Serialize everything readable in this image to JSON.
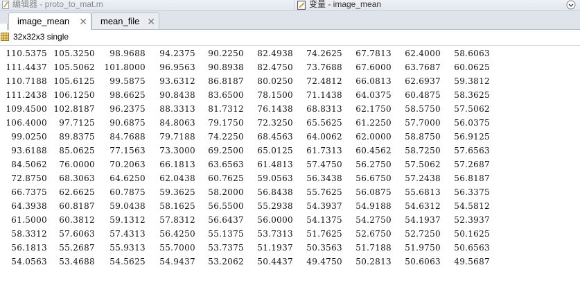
{
  "window": {
    "left_title": "编辑器 - proto_to_mat.m",
    "right_title": "变量 - image_mean"
  },
  "tabs": [
    {
      "label": "image_mean",
      "active": true
    },
    {
      "label": "mean_file",
      "active": false
    }
  ],
  "variable_info": "32x32x3 single",
  "matrix": [
    [
      "110.5375",
      "105.3250",
      "98.9688",
      "94.2375",
      "90.2250",
      "82.4938",
      "74.2625",
      "67.7813",
      "62.4000",
      "58.6063"
    ],
    [
      "111.4437",
      "105.5062",
      "101.8000",
      "96.9563",
      "90.8938",
      "82.4750",
      "73.7688",
      "67.6000",
      "63.7687",
      "60.0625"
    ],
    [
      "110.7188",
      "105.6125",
      "99.5875",
      "93.6312",
      "86.8187",
      "80.0250",
      "72.4812",
      "66.0813",
      "62.6937",
      "59.3812"
    ],
    [
      "111.2438",
      "106.1250",
      "98.6625",
      "90.8438",
      "83.6500",
      "78.1500",
      "71.1438",
      "64.0375",
      "60.4875",
      "58.3625"
    ],
    [
      "109.4500",
      "102.8187",
      "96.2375",
      "88.3313",
      "81.7312",
      "76.1438",
      "68.8313",
      "62.1750",
      "58.5750",
      "57.5062"
    ],
    [
      "106.4000",
      "97.7125",
      "90.6875",
      "84.8063",
      "79.1750",
      "72.3250",
      "65.5625",
      "61.2250",
      "57.7000",
      "56.0375"
    ],
    [
      "99.0250",
      "89.8375",
      "84.7688",
      "79.7188",
      "74.2250",
      "68.4563",
      "64.0062",
      "62.0000",
      "58.8750",
      "56.9125"
    ],
    [
      "93.6188",
      "85.0625",
      "77.1563",
      "73.3000",
      "69.2500",
      "65.0125",
      "61.7313",
      "60.4562",
      "58.7250",
      "57.6563"
    ],
    [
      "84.5062",
      "76.0000",
      "70.2063",
      "66.1813",
      "63.6563",
      "61.4813",
      "57.4750",
      "56.2750",
      "57.5062",
      "57.2687"
    ],
    [
      "72.8750",
      "68.3063",
      "64.6250",
      "62.0438",
      "60.7625",
      "59.0563",
      "56.3438",
      "56.6750",
      "57.2438",
      "56.8187"
    ],
    [
      "66.7375",
      "62.6625",
      "60.7875",
      "59.3625",
      "58.2000",
      "56.8438",
      "55.7625",
      "56.0875",
      "55.6813",
      "56.3375"
    ],
    [
      "64.3938",
      "60.8187",
      "59.0438",
      "58.1625",
      "56.5500",
      "55.2938",
      "54.3937",
      "54.9188",
      "54.6312",
      "54.5812"
    ],
    [
      "61.5000",
      "60.3812",
      "59.1312",
      "57.8312",
      "56.6437",
      "56.0000",
      "54.1375",
      "54.2750",
      "54.1937",
      "52.3937"
    ],
    [
      "58.3312",
      "57.6063",
      "57.4313",
      "56.4250",
      "55.1375",
      "53.7313",
      "51.7625",
      "52.6750",
      "52.7250",
      "50.1625"
    ],
    [
      "56.1813",
      "55.2687",
      "55.9313",
      "55.7000",
      "53.7375",
      "51.1937",
      "50.3563",
      "51.7188",
      "51.9750",
      "50.6563"
    ],
    [
      "54.0563",
      "53.4688",
      "54.5625",
      "54.9437",
      "53.2062",
      "50.4437",
      "49.4750",
      "50.2813",
      "50.6063",
      "49.5687"
    ]
  ],
  "icons": {
    "editor": "document-icon",
    "variable": "variable-doc-icon",
    "info": "grid-icon",
    "menu": "chevron-down-icon",
    "close": "close-icon"
  }
}
